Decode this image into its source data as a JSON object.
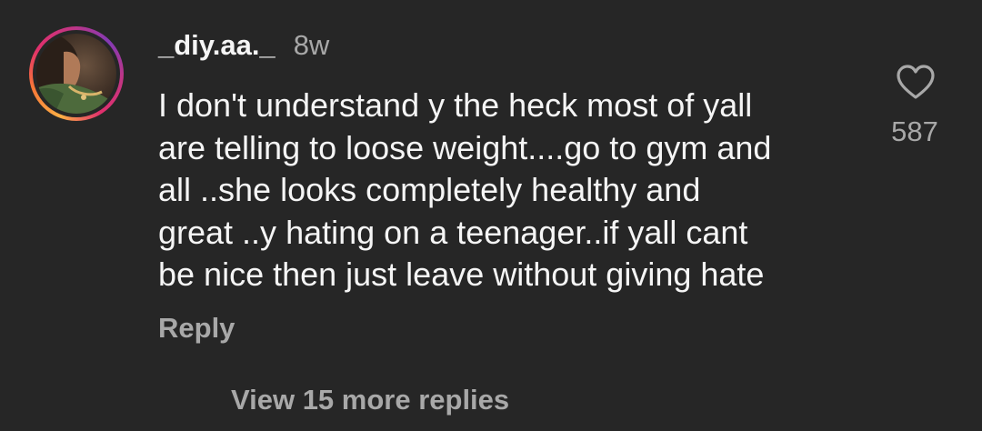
{
  "comment": {
    "username": "_diy.aa._",
    "time_ago": "8w",
    "text_lines": [
      "I don't understand y the heck most of yall",
      "are telling to loose weight....go to gym and",
      "all ..she looks completely healthy and",
      "great ..y hating on a teenager..if yall cant",
      "be nice then just leave without giving hate"
    ],
    "reply_label": "Reply",
    "like_icon": "heart-outline-icon",
    "like_count": "587",
    "view_replies_label": "View 15 more replies"
  },
  "colors": {
    "background": "#262626",
    "primary_text": "#f5f5f5",
    "secondary_text": "#a8a8a8",
    "story_ring": [
      "#fcaf45",
      "#f77737",
      "#e1306c",
      "#c13584",
      "#833ab4"
    ]
  }
}
